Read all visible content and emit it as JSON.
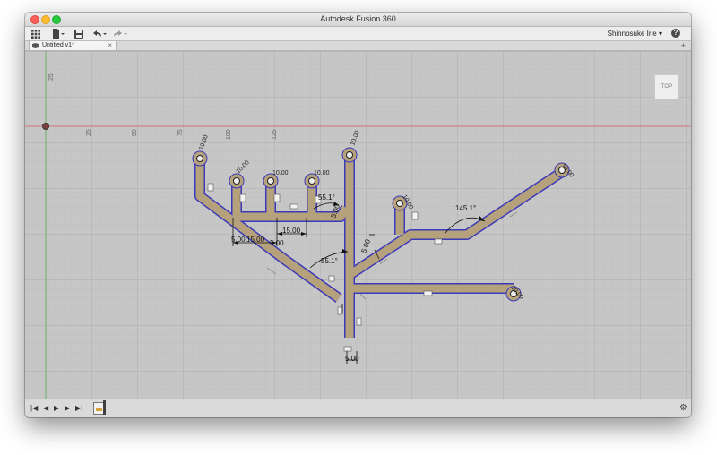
{
  "window": {
    "title": "Autodesk Fusion 360"
  },
  "toolbar": {
    "user_name": "Shinnosuke Irie ▾",
    "help_label": "?"
  },
  "tabs": [
    {
      "label": "Untitled v1*",
      "close_label": "×"
    }
  ],
  "tab_add_label": "+",
  "viewcube": {
    "label": "TOP"
  },
  "rulers": {
    "horizontal": [
      "25",
      "50",
      "75",
      "100",
      "125"
    ],
    "vertical": [
      "25"
    ]
  },
  "dimensions": {
    "angle_1": "55.1°",
    "angle_2": "55.1°",
    "angle_3": "145.1°",
    "len_1": "5.00",
    "len_2": "15.00",
    "len_3": "15.00",
    "len_4": "5.00",
    "len_5": "5.00",
    "len_6": "5.00",
    "len_7": "5.00",
    "pad_1": "10.00",
    "pad_2": "10.00",
    "pad_3": "10.00",
    "pad_4": "10.00",
    "pad_5": "10.00",
    "pad_6": "10.00",
    "pad_7": "10.00",
    "pad_8": "10.00"
  },
  "colors": {
    "trace_fill": "#b5a27c",
    "trace_outline": "#3c3ab8",
    "x_axis": "#d05050",
    "y_axis": "#4fa94f",
    "grid_minor": "#b9b9b9",
    "grid_major": "#a9a9a9"
  }
}
